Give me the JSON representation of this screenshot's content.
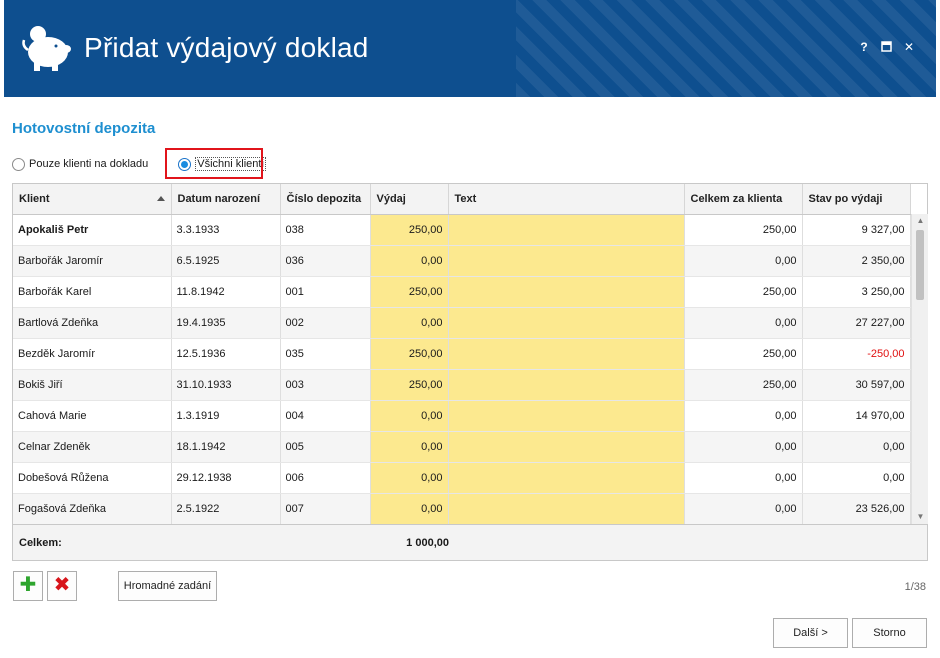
{
  "window": {
    "title": "Přidat výdajový doklad",
    "help_label": "?",
    "maximize_icon": "maximize-icon",
    "close_label": "✕"
  },
  "section_title": "Hotovostní depozita",
  "filter": {
    "option1": "Pouze klienti na dokladu",
    "option2": "Všichni klienti",
    "selected": "option2"
  },
  "grid": {
    "columns": [
      "Klient",
      "Datum narození",
      "Číslo depozita",
      "Výdaj",
      "Text",
      "Celkem za klienta",
      "Stav po výdaji"
    ],
    "rows": [
      {
        "klient": "Apokališ Petr",
        "datum": "3.3.1933",
        "cislo": "038",
        "vydaj": "250,00",
        "text": "",
        "celkem": "250,00",
        "stav": "9 327,00"
      },
      {
        "klient": "Barbořák Jaromír",
        "datum": "6.5.1925",
        "cislo": "036",
        "vydaj": "0,00",
        "text": "",
        "celkem": "0,00",
        "stav": "2 350,00"
      },
      {
        "klient": "Barbořák Karel",
        "datum": "11.8.1942",
        "cislo": "001",
        "vydaj": "250,00",
        "text": "",
        "celkem": "250,00",
        "stav": "3 250,00"
      },
      {
        "klient": "Bartlová Zdeňka",
        "datum": "19.4.1935",
        "cislo": "002",
        "vydaj": "0,00",
        "text": "",
        "celkem": "0,00",
        "stav": "27 227,00"
      },
      {
        "klient": "Bezděk Jaromír",
        "datum": "12.5.1936",
        "cislo": "035",
        "vydaj": "250,00",
        "text": "",
        "celkem": "250,00",
        "stav": "-250,00"
      },
      {
        "klient": "Bokiš Jiří",
        "datum": "31.10.1933",
        "cislo": "003",
        "vydaj": "250,00",
        "text": "",
        "celkem": "250,00",
        "stav": "30 597,00"
      },
      {
        "klient": "Cahová Marie",
        "datum": "1.3.1919",
        "cislo": "004",
        "vydaj": "0,00",
        "text": "",
        "celkem": "0,00",
        "stav": "14 970,00"
      },
      {
        "klient": "Celnar Zdeněk",
        "datum": "18.1.1942",
        "cislo": "005",
        "vydaj": "0,00",
        "text": "",
        "celkem": "0,00",
        "stav": "0,00"
      },
      {
        "klient": "Dobešová Růžena",
        "datum": "29.12.1938",
        "cislo": "006",
        "vydaj": "0,00",
        "text": "",
        "celkem": "0,00",
        "stav": "0,00"
      },
      {
        "klient": "Fogašová Zdeňka",
        "datum": "2.5.1922",
        "cislo": "007",
        "vydaj": "0,00",
        "text": "",
        "celkem": "0,00",
        "stav": "23 526,00"
      }
    ],
    "total_label": "Celkem:",
    "total_value": "1 000,00",
    "scroll_up": "▲",
    "scroll_down": "▼"
  },
  "toolbar": {
    "add_label": "✚",
    "delete_label": "✖",
    "bulk_label": "Hromadné zadání",
    "page_info": "1/38"
  },
  "footer": {
    "next_label": "Další >",
    "cancel_label": "Storno"
  },
  "colors": {
    "header": "#0e4f8f",
    "accent": "#1e8fd0",
    "yellow_cell": "#fce98f",
    "negative": "#e01010",
    "add_icon": "#2ea52e",
    "delete_icon": "#d8151b"
  }
}
